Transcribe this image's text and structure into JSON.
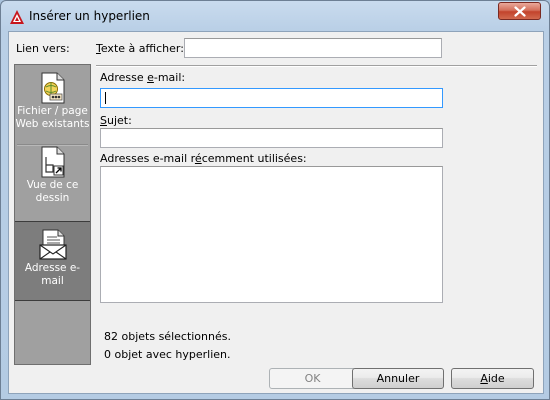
{
  "window": {
    "title": "Insérer un hyperlien"
  },
  "link_to": {
    "label": "Lien vers:"
  },
  "display_text": {
    "label": "Texte à afficher:",
    "value": ""
  },
  "sidebar": {
    "items": [
      {
        "label": "Fichier / page Web existants",
        "icon": "existing-file-web-page-icon"
      },
      {
        "label": "Vue de ce dessin",
        "icon": "view-of-drawing-icon"
      },
      {
        "label": "Adresse e-mail",
        "icon": "email-address-icon",
        "selected": true
      }
    ]
  },
  "email": {
    "label": "Adresse e-mail:",
    "value": ""
  },
  "subject": {
    "label": "Sujet:",
    "value": ""
  },
  "recent": {
    "label": "Adresses e-mail récemment utilisées:",
    "items": []
  },
  "status": {
    "selected_objects": "82 objets sélectionnés.",
    "hyperlink_objects": "0 objet avec hyperlien."
  },
  "buttons": {
    "ok": "OK",
    "cancel": "Annuler",
    "help": "Aide"
  },
  "colors": {
    "accent_focus": "#3399ff",
    "sidebar_bg": "#a0a0a0",
    "sidebar_selected": "#7d7d7d",
    "close_button": "#c2432c"
  }
}
